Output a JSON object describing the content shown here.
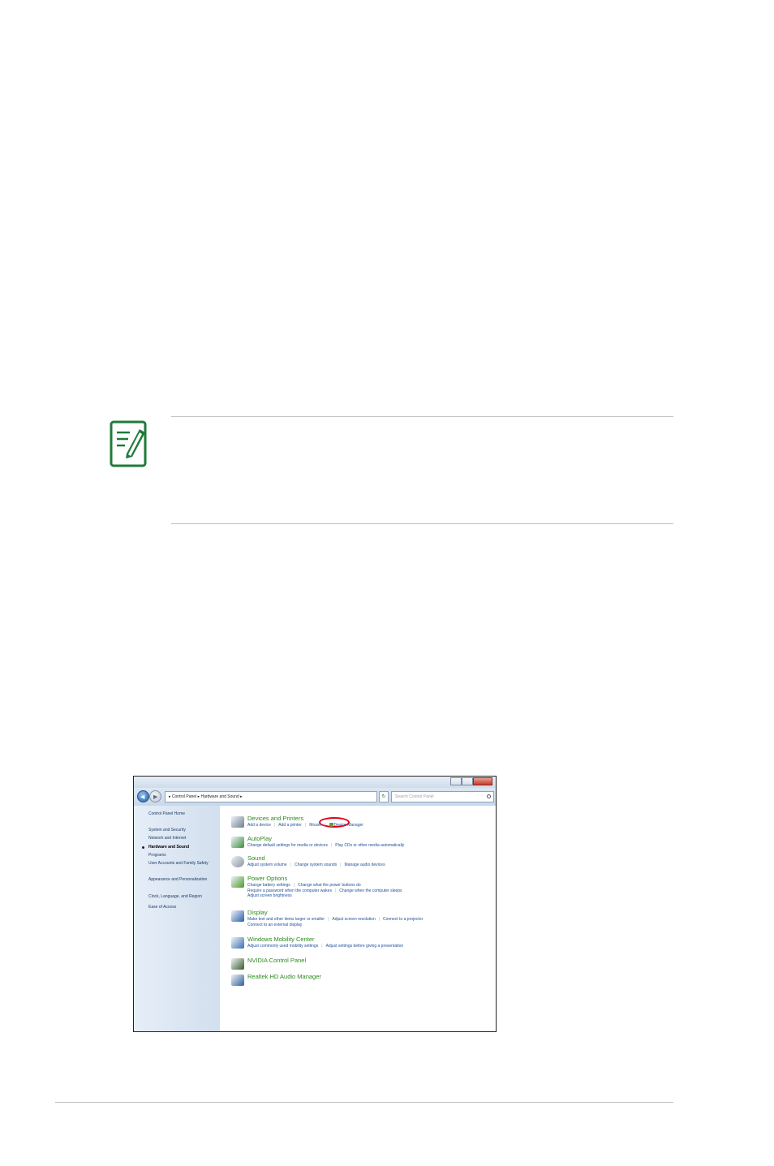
{
  "window": {
    "breadcrumb": "▸ Control Panel ▸ Hardware and Sound ▸",
    "search_placeholder": "Search Control Panel"
  },
  "sidebar": {
    "items": [
      "Control Panel Home",
      "System and Security",
      "Network and Internet",
      "Hardware and Sound",
      "Programs",
      "User Accounts and Family Safety",
      "Appearance and Personalization",
      "Clock, Language, and Region",
      "Ease of Access"
    ],
    "active_index": 3
  },
  "categories": [
    {
      "title": "Devices and Printers",
      "links": [
        "Add a device",
        "Add a printer",
        "Mouse",
        "Device Manager"
      ],
      "icon": "printer-icon"
    },
    {
      "title": "AutoPlay",
      "links": [
        "Change default settings for media or devices",
        "Play CDs or other media automatically"
      ],
      "icon": "autoplay-icon"
    },
    {
      "title": "Sound",
      "links": [
        "Adjust system volume",
        "Change system sounds",
        "Manage audio devices"
      ],
      "icon": "speaker-icon"
    },
    {
      "title": "Power Options",
      "links": [
        "Change battery settings",
        "Change what the power buttons do",
        "Require a password when the computer wakes",
        "Change when the computer sleeps",
        "Adjust screen brightness"
      ],
      "icon": "power-icon"
    },
    {
      "title": "Display",
      "links": [
        "Make text and other items larger or smaller",
        "Adjust screen resolution",
        "Connect to a projector",
        "Connect to an external display"
      ],
      "icon": "display-icon"
    },
    {
      "title": "Windows Mobility Center",
      "links": [
        "Adjust commonly used mobility settings",
        "Adjust settings before giving a presentation"
      ],
      "icon": "mobility-icon"
    },
    {
      "title": "NVIDIA Control Panel",
      "links": [],
      "icon": "nvidia-icon"
    },
    {
      "title": "Realtek HD Audio Manager",
      "links": [],
      "icon": "realtek-icon"
    }
  ],
  "colors": {
    "note_icon": "#1f7a3a",
    "highlight_ring": "#e0001a",
    "category_title": "#2d8a1e",
    "link": "#1f4f9a"
  }
}
